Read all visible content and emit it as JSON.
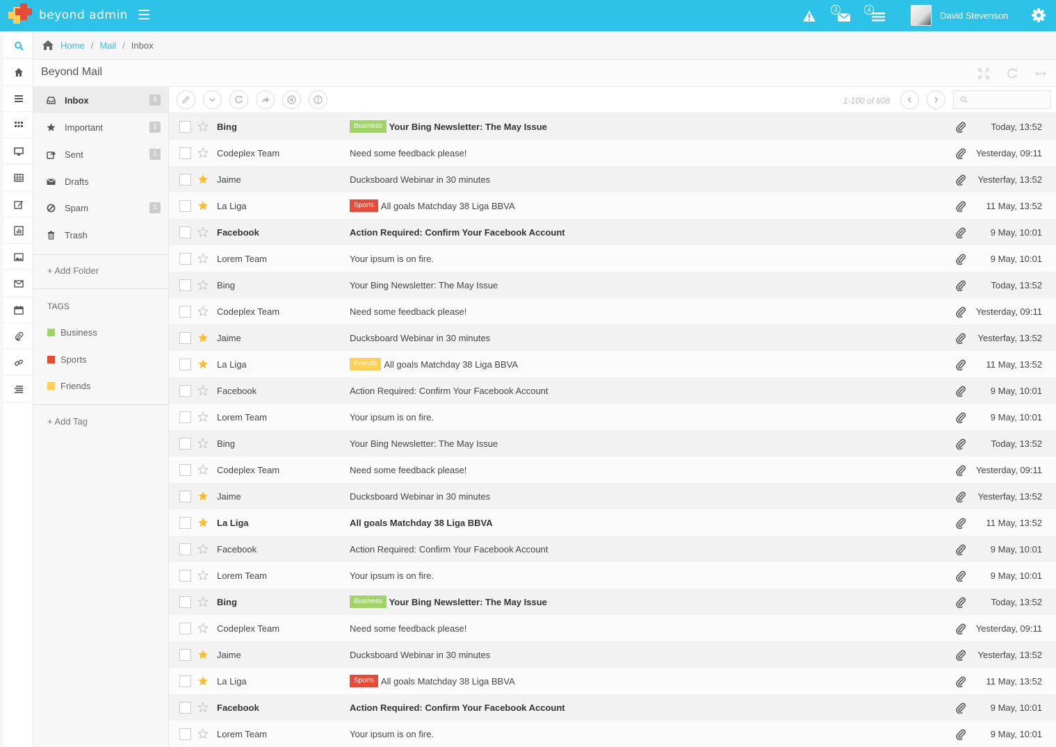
{
  "app": {
    "title": "beyond admin",
    "brand_color": "#2dc3e8"
  },
  "navbar": {
    "messages_count": "3",
    "tasks_count": "4",
    "user_name": "David Stevenson"
  },
  "breadcrumb": {
    "home": "Home",
    "mail": "Mail",
    "current": "Inbox"
  },
  "page": {
    "title": "Beyond Mail"
  },
  "folders": [
    {
      "label": "Inbox",
      "count": "6",
      "icon": "inbox-icon"
    },
    {
      "label": "Important",
      "count": "1",
      "icon": "star-icon"
    },
    {
      "label": "Sent",
      "count": "1",
      "icon": "share-icon"
    },
    {
      "label": "Drafts",
      "count": "",
      "icon": "envelope-icon"
    },
    {
      "label": "Spam",
      "count": "1",
      "icon": "ban-icon"
    },
    {
      "label": "Trash",
      "count": "",
      "icon": "trash-icon"
    }
  ],
  "sidebar": {
    "add_folder": "+ Add Folder",
    "tags_title": "TAGS",
    "add_tag": "+ Add Tag"
  },
  "tags": [
    {
      "label": "Business",
      "color": "#a0d468"
    },
    {
      "label": "Sports",
      "color": "#e74b37"
    },
    {
      "label": "Friends",
      "color": "#ffce55"
    }
  ],
  "toolbar": {
    "pager": "1-100 of 608",
    "search_placeholder": ""
  },
  "mails": [
    {
      "sender": "Bing",
      "label": "Business",
      "label_color": "#a0d468",
      "subject": "Your Bing Newsletter: The May Issue",
      "time": "Today, 13:52",
      "starred": false,
      "unread": true
    },
    {
      "sender": "Codeplex Team",
      "label": "",
      "label_color": "",
      "subject": "Need some feedback please!",
      "time": "Yesterday, 09:11",
      "starred": false,
      "unread": false
    },
    {
      "sender": "Jaime",
      "label": "",
      "label_color": "",
      "subject": "Ducksboard Webinar in 30 minutes",
      "time": "Yesterfay, 13:52",
      "starred": true,
      "unread": false
    },
    {
      "sender": "La Liga",
      "label": "Sports",
      "label_color": "#e74b37",
      "subject": "All goals Matchday 38 Liga BBVA",
      "time": "11 May, 13:52",
      "starred": true,
      "unread": false
    },
    {
      "sender": "Facebook",
      "label": "",
      "label_color": "",
      "subject": "Action Required: Confirm Your Facebook Account",
      "time": "9 May, 10:01",
      "starred": false,
      "unread": true
    },
    {
      "sender": "Lorem Team",
      "label": "",
      "label_color": "",
      "subject": "Your ipsum is on fire.",
      "time": "9 May, 10:01",
      "starred": false,
      "unread": false
    },
    {
      "sender": "Bing",
      "label": "",
      "label_color": "",
      "subject": "Your Bing Newsletter: The May Issue",
      "time": "Today, 13:52",
      "starred": false,
      "unread": false
    },
    {
      "sender": "Codeplex Team",
      "label": "",
      "label_color": "",
      "subject": "Need some feedback please!",
      "time": "Yesterday, 09:11",
      "starred": false,
      "unread": false
    },
    {
      "sender": "Jaime",
      "label": "",
      "label_color": "",
      "subject": "Ducksboard Webinar in 30 minutes",
      "time": "Yesterfay, 13:52",
      "starred": true,
      "unread": false
    },
    {
      "sender": "La Liga",
      "label": "Friends",
      "label_color": "#ffce55",
      "subject": "All goals Matchday 38 Liga BBVA",
      "time": "11 May, 13:52",
      "starred": true,
      "unread": false
    },
    {
      "sender": "Facebook",
      "label": "",
      "label_color": "",
      "subject": "Action Required: Confirm Your Facebook Account",
      "time": "9 May, 10:01",
      "starred": false,
      "unread": false
    },
    {
      "sender": "Lorem Team",
      "label": "",
      "label_color": "",
      "subject": "Your ipsum is on fire.",
      "time": "9 May, 10:01",
      "starred": false,
      "unread": false
    },
    {
      "sender": "Bing",
      "label": "",
      "label_color": "",
      "subject": "Your Bing Newsletter: The May Issue",
      "time": "Today, 13:52",
      "starred": false,
      "unread": false
    },
    {
      "sender": "Codeplex Team",
      "label": "",
      "label_color": "",
      "subject": "Need some feedback please!",
      "time": "Yesterday, 09:11",
      "starred": false,
      "unread": false
    },
    {
      "sender": "Jaime",
      "label": "",
      "label_color": "",
      "subject": "Ducksboard Webinar in 30 minutes",
      "time": "Yesterfay, 13:52",
      "starred": true,
      "unread": false
    },
    {
      "sender": "La Liga",
      "label": "",
      "label_color": "",
      "subject": "All goals Matchday 38 Liga BBVA",
      "time": "11 May, 13:52",
      "starred": true,
      "unread": true
    },
    {
      "sender": "Facebook",
      "label": "",
      "label_color": "",
      "subject": "Action Required: Confirm Your Facebook Account",
      "time": "9 May, 10:01",
      "starred": false,
      "unread": false
    },
    {
      "sender": "Lorem Team",
      "label": "",
      "label_color": "",
      "subject": "Your ipsum is on fire.",
      "time": "9 May, 10:01",
      "starred": false,
      "unread": false
    },
    {
      "sender": "Bing",
      "label": "Business",
      "label_color": "#a0d468",
      "subject": "Your Bing Newsletter: The May Issue",
      "time": "Today, 13:52",
      "starred": false,
      "unread": true
    },
    {
      "sender": "Codeplex Team",
      "label": "",
      "label_color": "",
      "subject": "Need some feedback please!",
      "time": "Yesterday, 09:11",
      "starred": false,
      "unread": false
    },
    {
      "sender": "Jaime",
      "label": "",
      "label_color": "",
      "subject": "Ducksboard Webinar in 30 minutes",
      "time": "Yesterfay, 13:52",
      "starred": true,
      "unread": false
    },
    {
      "sender": "La Liga",
      "label": "Sports",
      "label_color": "#e74b37",
      "subject": "All goals Matchday 38 Liga BBVA",
      "time": "11 May, 13:52",
      "starred": true,
      "unread": false
    },
    {
      "sender": "Facebook",
      "label": "",
      "label_color": "",
      "subject": "Action Required: Confirm Your Facebook Account",
      "time": "9 May, 10:01",
      "starred": false,
      "unread": true
    },
    {
      "sender": "Lorem Team",
      "label": "",
      "label_color": "",
      "subject": "Your ipsum is on fire.",
      "time": "9 May, 10:01",
      "starred": false,
      "unread": false
    }
  ]
}
